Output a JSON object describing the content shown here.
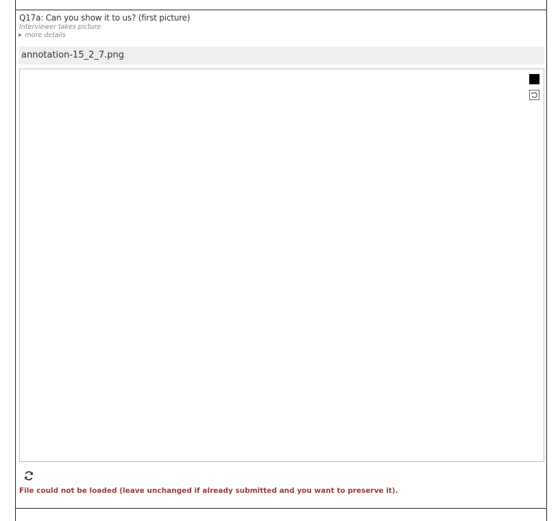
{
  "question": {
    "label": "Q17a: Can you show it to us? (first picture)",
    "hint": "Interviewer takes picture",
    "details_toggle": "more details"
  },
  "file": {
    "name": "annotation-15_2_7.png"
  },
  "canvas_tools": {
    "color": "#000000",
    "reset_icon": "undo-icon"
  },
  "reload": {
    "icon": "refresh-icon"
  },
  "status": {
    "error": "File could not be loaded (leave unchanged if already submitted and you want to preserve it)."
  },
  "colors": {
    "error": "#9a3b3b",
    "file_bar_bg": "#eeeeee",
    "hint": "#888888"
  }
}
